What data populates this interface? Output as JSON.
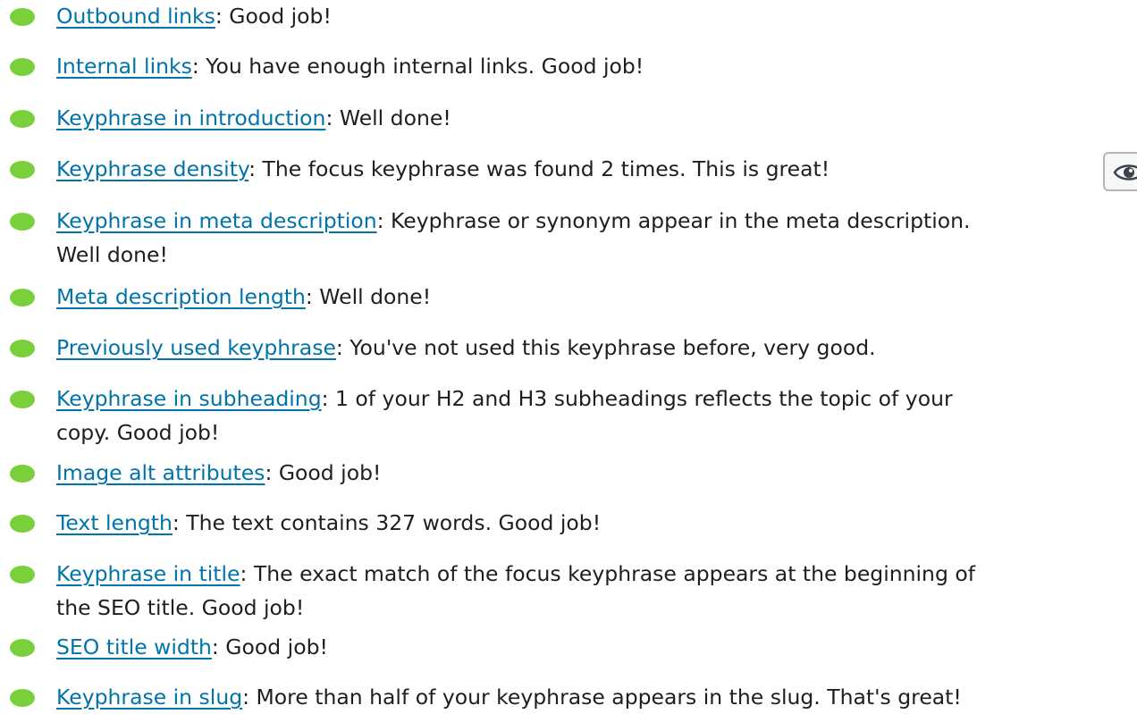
{
  "results": [
    {
      "link": "Outbound links",
      "text": ": Good job!",
      "status": "good"
    },
    {
      "link": "Internal links",
      "text": ": You have enough internal links. Good job!",
      "status": "good"
    },
    {
      "link": "Keyphrase in introduction",
      "text": ": Well done!",
      "status": "good"
    },
    {
      "link": "Keyphrase density",
      "text": ": The focus keyphrase was found 2 times. This is great!",
      "status": "good"
    },
    {
      "link": "Keyphrase in meta description",
      "text": ": Keyphrase or synonym appear in the meta description.",
      "text2": "Well done!",
      "status": "good"
    },
    {
      "link": "Meta description length",
      "text": ": Well done!",
      "status": "good"
    },
    {
      "link": "Previously used keyphrase",
      "text": ": You've not used this keyphrase before, very good.",
      "status": "good"
    },
    {
      "link": "Keyphrase in subheading",
      "text": ": 1 of your H2 and H3 subheadings reflects the topic of your",
      "text2": "copy. Good job!",
      "status": "good"
    },
    {
      "link": "Image alt attributes",
      "text": ": Good job!",
      "status": "good"
    },
    {
      "link": "Text length",
      "text": ": The text contains 327 words. Good job!",
      "status": "good"
    },
    {
      "link": "Keyphrase in title",
      "text": ": The exact match of the focus keyphrase appears at the beginning of",
      "text2": "the SEO title. Good job!",
      "status": "good"
    },
    {
      "link": "SEO title width",
      "text": ": Good job!",
      "status": "good"
    },
    {
      "link": "Keyphrase in slug",
      "text": ": More than half of your keyphrase appears in the slug. That's great!",
      "status": "good"
    }
  ],
  "colors": {
    "good_bullet": "#7ad03a",
    "link": "#0073aa"
  },
  "icons": {
    "highlight_button": "eye-icon"
  }
}
